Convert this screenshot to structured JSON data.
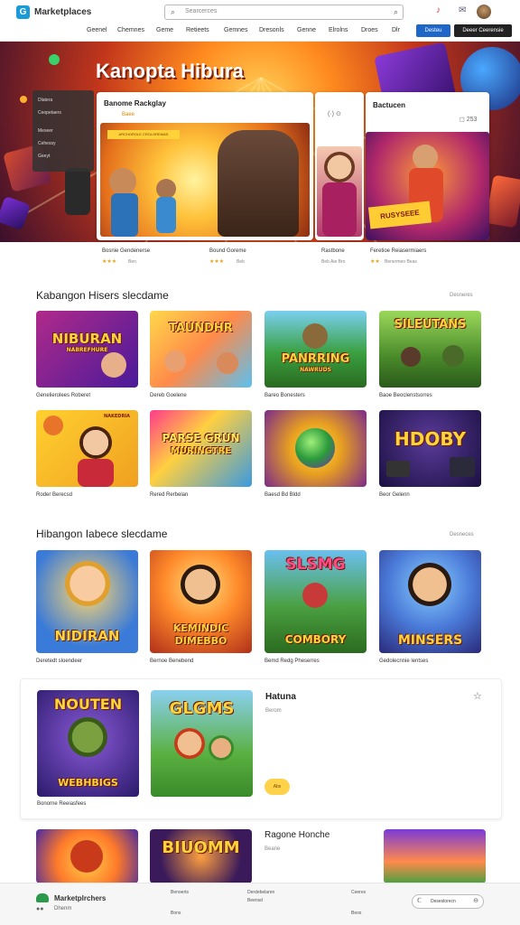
{
  "header": {
    "brand": "Marketplaces",
    "search_placeholder": "Searcerces",
    "nav": [
      "Geenel",
      "Chemnes",
      "Geme",
      "Retieets",
      "Gemnes",
      "Dresonls",
      "Genne",
      "Elrolns",
      "Droes",
      "Dlr"
    ],
    "btn_primary": "Desteu",
    "btn_secondary": "Deeer Ceerensie"
  },
  "hero": {
    "title": "Kanopta Hibura",
    "panel_items": [
      "Dlatera",
      "Ceopetaers",
      "Meseer",
      "Cehessy",
      "Geeyt"
    ],
    "card1": {
      "title": "Banome Rackglay",
      "sub": "Baee",
      "banner": "ARCHOROLE CROLOREMAS"
    },
    "card2": {
      "controls": "(·) ⊙"
    },
    "card3": {
      "title": "Bactucen",
      "meta": "◻ 253",
      "badge": "RUSYSEEE"
    },
    "captions": [
      {
        "name": "Bosnie Gendenerse",
        "rating": "★★★",
        "meta": "Ben"
      },
      {
        "name": "Bound Goreme",
        "rating": "★★★",
        "meta": "Beb"
      },
      {
        "name": "Rastbone",
        "rating": "",
        "meta": "Beb Aie Bro"
      },
      {
        "name": "Feretioe Reiasermiaers",
        "rating": "★★",
        "meta": "Benermeo Beas"
      }
    ]
  },
  "section1": {
    "title": "Kabangon Hisers slecdame",
    "link": "Desneres",
    "tiles": [
      {
        "art": "NIBURAN",
        "sub": "NABREFHURE",
        "caption": "Genelierolees Roberet"
      },
      {
        "art": "TAUNDHR",
        "sub": "",
        "caption": "Dereb Goelene"
      },
      {
        "art": "PANRRING",
        "sub": "NAWRUDS",
        "caption": "Bareo Bonesters"
      },
      {
        "art": "SILEUTANS",
        "sub": "",
        "caption": "Baoe Beoclenstsorres"
      },
      {
        "art": "",
        "sub": "NAKEDRIA",
        "caption": "Roder Berecsd"
      },
      {
        "art": "PARSE GRUN",
        "sub": "MURINGTRE",
        "caption": "Rered Rerbelan"
      },
      {
        "art": "",
        "sub": "",
        "caption": "Baesd Bd Bldd"
      },
      {
        "art": "HDOBY",
        "sub": "",
        "caption": "Beor Gelenn"
      }
    ]
  },
  "section2": {
    "title": "Hibangon Iabece slecdame",
    "link": "Desneces",
    "tiles": [
      {
        "art": "NIDIRAN",
        "sub": "",
        "caption": "Deretedt sloendeer"
      },
      {
        "art": "KEMINDIC",
        "sub": "DIMEBBO",
        "caption": "Bernoe Benebend"
      },
      {
        "art": "SLSMG",
        "sub": "COMBORY",
        "caption": "Bemd Redg Pheserres"
      },
      {
        "art": "MINSERS",
        "sub": "",
        "caption": "Gedolecnnie lentses"
      }
    ]
  },
  "feature": {
    "tiles": [
      {
        "art": "NOUTEN",
        "sub": "WEBHBIGS",
        "caption": "Bonorne Reeiasfees"
      },
      {
        "art": "GLGMS",
        "sub": "",
        "caption": ""
      }
    ],
    "title": "Hatuna",
    "sub": "Berom",
    "pill": "Abs"
  },
  "bottom_row": {
    "tiles": [
      {
        "art": "",
        "sub": ""
      },
      {
        "art": "BIUOMM",
        "sub": ""
      }
    ],
    "title": "Ragone Honche",
    "sub": "Beane"
  },
  "footer": {
    "brand": "Marketplrchers",
    "sub": "Dhenm",
    "links": [
      [
        "Benoerts",
        "Bons"
      ],
      [
        "Derdebelaren",
        "Beensd"
      ],
      [
        "Ceeres",
        "Beos"
      ]
    ],
    "button": "Deseslorecn"
  },
  "colors": {
    "accent": "#1e66c8",
    "brand": "#1a9bd7",
    "star": "#e8a21a",
    "art_title": "#ffd33b"
  }
}
